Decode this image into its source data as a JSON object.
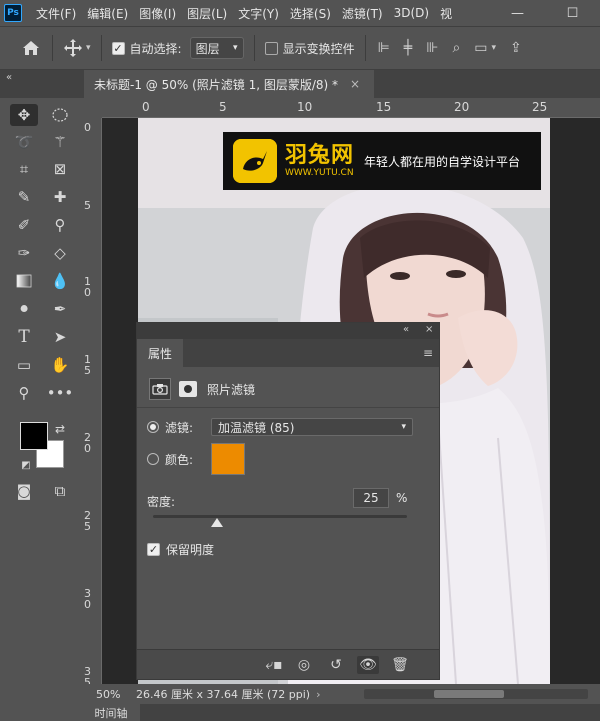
{
  "app": {
    "logo_text": "Ps",
    "menu": [
      "文件(F)",
      "编辑(E)",
      "图像(I)",
      "图层(L)",
      "文字(Y)",
      "选择(S)",
      "滤镜(T)",
      "3D(D)",
      "视"
    ],
    "window_controls": [
      "—",
      "☐"
    ]
  },
  "options_bar": {
    "auto_select_label": "自动选择:",
    "auto_select_checked": true,
    "auto_select_target": "图层",
    "show_transform_label": "显示变换控件",
    "show_transform_checked": false
  },
  "document": {
    "collapse_icon": "«",
    "tab_title": "未标题-1 @ 50% (照片滤镜 1, 图层蒙版/8) *",
    "tab_close": "×"
  },
  "rulers": {
    "top": [
      "0",
      "5",
      "10",
      "15",
      "20",
      "25"
    ],
    "left": [
      "0",
      "5",
      "1\n0",
      "1\n5",
      "2\n0",
      "2\n5",
      "3\n0",
      "3\n5"
    ]
  },
  "watermark": {
    "brand": "羽兔网",
    "url": "WWW.YUTU.CN",
    "slogan": "年轻人都在用的自学设计平台"
  },
  "properties_panel": {
    "collapse": "«",
    "close": "×",
    "tab_label": "属性",
    "menu_icon": "≡",
    "header_label": "照片滤镜",
    "filter_label": "滤镜:",
    "filter_value": "加温滤镜 (85)",
    "filter_selected": true,
    "color_label": "颜色:",
    "color_value": "#ed8b00",
    "density_label": "密度:",
    "density_value": "25",
    "density_unit": "%",
    "density_level": 0.25,
    "preserve_luminosity_label": "保留明度",
    "preserve_luminosity_checked": true
  },
  "status_bar": {
    "zoom": "50%",
    "doc_info": "26.46 厘米 x 37.64 厘米 (72 ppi)",
    "arrow": "›"
  },
  "bottom_panel": {
    "tab_label": "时间轴"
  },
  "icons": {
    "move": "move-icon",
    "marquee": "marquee-icon",
    "lasso": "lasso-icon",
    "magic_wand": "magic-wand-icon",
    "crop": "crop-icon",
    "frame": "frame-icon",
    "eyedropper": "eyedropper-icon",
    "healing": "healing-brush-icon",
    "brush": "brush-icon",
    "stamp": "clone-stamp-icon",
    "history_brush": "history-brush-icon",
    "eraser": "eraser-icon",
    "gradient": "gradient-icon",
    "blur": "blur-icon",
    "dodge": "dodge-icon",
    "pen": "pen-icon",
    "type": "type-icon",
    "path_select": "path-selection-icon",
    "rectangle": "rectangle-icon",
    "hand": "hand-icon",
    "zoom": "zoom-icon",
    "more": "more-icon"
  }
}
